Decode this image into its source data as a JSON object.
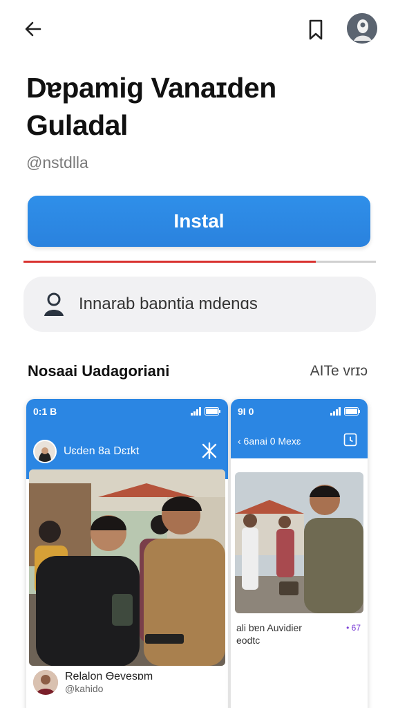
{
  "app": {
    "title": "Dɐpamig Vanaɪden Guladal",
    "developer": "@nstdlla",
    "install_label": "Instal",
    "install_progress": 0.83,
    "info_text": "Innarab baɒntia mdenɑs"
  },
  "section": {
    "title": "Nosaai Uadagoriani",
    "link": "AITe vrɪɔ"
  },
  "screenshots": [
    {
      "status_time": "0:1 B",
      "appbar_title": "Uɛden 8a Dɛɪkt",
      "post_name": "Relalon Ɵevesɒm",
      "post_handle": "@kahido"
    },
    {
      "status_time": "9I 0",
      "appbar_title": "‹ 6anai 0 Mexɛ",
      "caption_line1": "ali bɐn Auvidier",
      "caption_line2": "eodtc",
      "caption_tag": "• 67"
    }
  ],
  "colors": {
    "accent": "#2b86e3",
    "progress": "#d9322f",
    "card_bg": "#f1f1f3"
  },
  "icons": {
    "back": "back-arrow-icon",
    "bookmark": "bookmark-icon",
    "profile": "profile-avatar-icon",
    "info": "person-icon"
  }
}
